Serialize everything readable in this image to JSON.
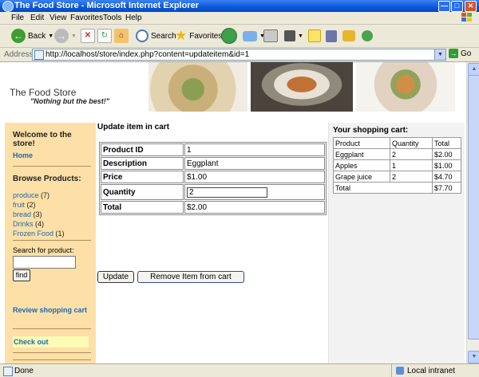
{
  "window": {
    "title": "The Food Store - Microsoft Internet Explorer"
  },
  "menu": [
    "File",
    "Edit",
    "View",
    "Favorites",
    "Tools",
    "Help"
  ],
  "toolbar": {
    "back_label": "Back",
    "search_label": "Search",
    "favorites_label": "Favorites"
  },
  "address": {
    "label": "Address",
    "url": "http://localhost/store/index.php?content=updateitem&id=1",
    "go_label": "Go"
  },
  "header": {
    "site_title": "The Food Store",
    "tagline": "\"Nothing but the best!\""
  },
  "sidebar": {
    "welcome": "Welcome to the store!",
    "home": "Home",
    "browse_heading": "Browse Products:",
    "categories": [
      {
        "name": "produce",
        "count": "(7)"
      },
      {
        "name": "fruit",
        "count": "(2)"
      },
      {
        "name": "bread",
        "count": "(3)"
      },
      {
        "name": "Drinks",
        "count": "(4)"
      },
      {
        "name": "Frozen Food",
        "count": "(1)"
      }
    ],
    "search_label": "Search for product:",
    "search_value": "",
    "find_label": "find",
    "review_cart": "Review shopping cart",
    "checkout": "Check out"
  },
  "main": {
    "heading": "Update item in cart",
    "rows": {
      "product_id": {
        "label": "Product ID",
        "value": "1"
      },
      "description": {
        "label": "Description",
        "value": "Eggplant"
      },
      "price": {
        "label": "Price",
        "value": "$1.00"
      },
      "quantity": {
        "label": "Quantity",
        "value": "2"
      },
      "total": {
        "label": "Total",
        "value": "$2.00"
      }
    },
    "update_label": "Update",
    "remove_label": "Remove Item from cart"
  },
  "cart": {
    "heading": "Your shopping cart:",
    "columns": [
      "Product",
      "Quantity",
      "Total"
    ],
    "items": [
      {
        "product": "Eggplant",
        "quantity": "2",
        "total": "$2.00"
      },
      {
        "product": "Apples",
        "quantity": "1",
        "total": "$1.00"
      },
      {
        "product": "Grape juice",
        "quantity": "2",
        "total": "$4.70"
      }
    ],
    "total_label": "Total",
    "total_value": "$7.70"
  },
  "status": {
    "text": "Done",
    "zone": "Local intranet"
  }
}
